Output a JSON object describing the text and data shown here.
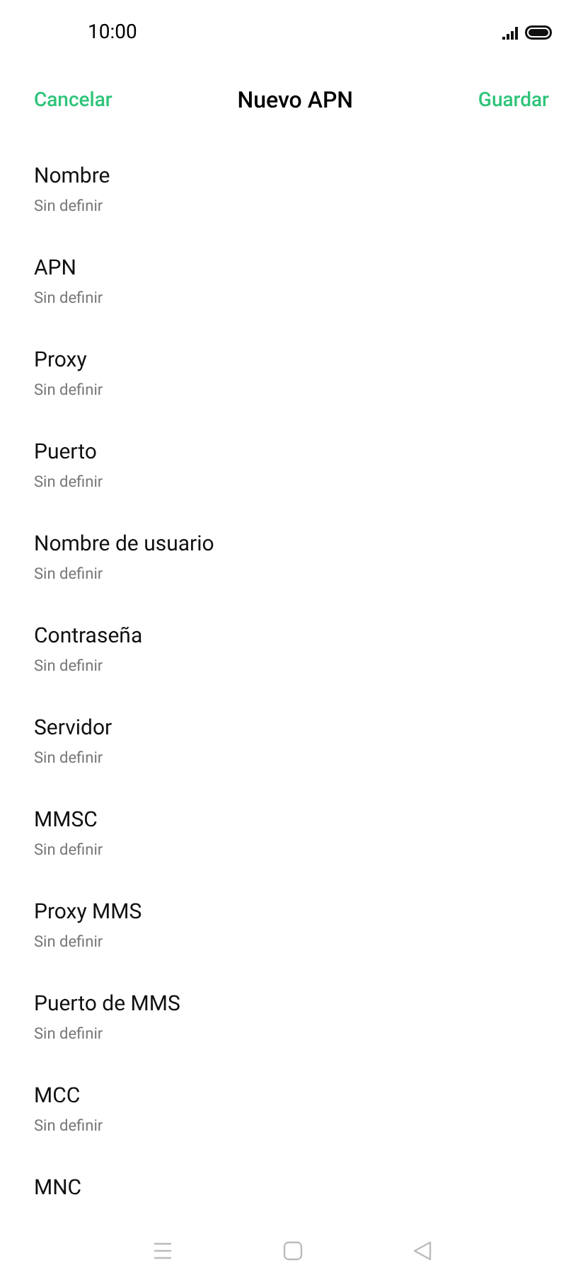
{
  "status_bar": {
    "time": "10:00"
  },
  "header": {
    "cancel": "Cancelar",
    "title": "Nuevo APN",
    "save": "Guardar"
  },
  "fields": [
    {
      "label": "Nombre",
      "value": "Sin definir"
    },
    {
      "label": "APN",
      "value": "Sin definir"
    },
    {
      "label": "Proxy",
      "value": "Sin definir"
    },
    {
      "label": "Puerto",
      "value": "Sin definir"
    },
    {
      "label": "Nombre de usuario",
      "value": "Sin definir"
    },
    {
      "label": "Contraseña",
      "value": "Sin definir"
    },
    {
      "label": "Servidor",
      "value": "Sin definir"
    },
    {
      "label": "MMSC",
      "value": "Sin definir"
    },
    {
      "label": "Proxy MMS",
      "value": "Sin definir"
    },
    {
      "label": "Puerto de MMS",
      "value": "Sin definir"
    },
    {
      "label": "MCC",
      "value": "Sin definir"
    },
    {
      "label": "MNC"
    }
  ]
}
